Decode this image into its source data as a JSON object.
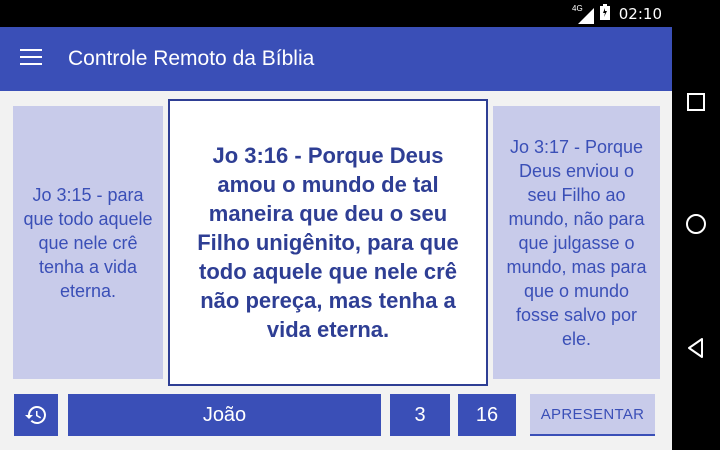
{
  "status_bar": {
    "network": "4G",
    "time": "02:10",
    "icons": [
      "signal-icon",
      "battery-icon"
    ]
  },
  "app_bar": {
    "title": "Controle Remoto da Bíblia",
    "menu_icon": "hamburger-menu-icon"
  },
  "verses": {
    "previous": "Jo 3:15 - para que todo aquele que nele crê tenha a vida eterna.",
    "current": "Jo 3:16 - Porque Deus amou o mundo de tal maneira que deu o seu Filho unigênito, para que todo aquele que nele crê não pereça, mas tenha a vida eterna.",
    "next": "Jo 3:17 - Porque Deus enviou o seu Filho ao mundo, não para que julgasse o mundo, mas para que o mundo fosse salvo por ele."
  },
  "controls": {
    "history_icon": "history-icon",
    "book": "João",
    "chapter": "3",
    "verse": "16",
    "present_label": "APRESENTAR"
  },
  "nav_bar": {
    "icons": [
      "square-icon",
      "circle-icon",
      "triangle-back-icon"
    ]
  },
  "colors": {
    "primary": "#3a4fb7",
    "side_card": "#c8cbea",
    "background": "#f2f2f2"
  }
}
